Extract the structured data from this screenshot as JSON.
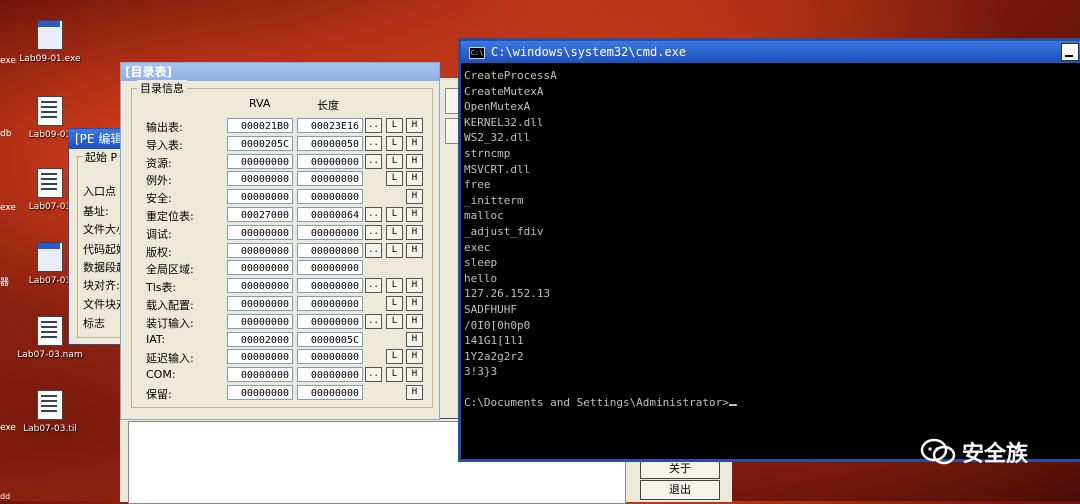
{
  "desktop": {
    "icons": [
      {
        "label": "Lab09-01.exe",
        "kind": "win"
      },
      {
        "label": "Lab09-01",
        "kind": "doc"
      },
      {
        "label": "Lab07-03",
        "kind": "doc"
      },
      {
        "label": "Lab07-03",
        "kind": "win"
      },
      {
        "label": "Lab07-03.nam",
        "kind": "doc"
      },
      {
        "label": "Lab07-03.til",
        "kind": "doc"
      }
    ],
    "edge_texts": [
      "exe",
      "db",
      "exe",
      "器",
      "exe",
      "dd"
    ]
  },
  "pe_editor": {
    "title": "[PE 编辑",
    "group_label": "起始 P",
    "fields": [
      "入口点",
      "基址:",
      "文件大小",
      "代码起始",
      "数据段起",
      "块对齐:",
      "文件块对",
      "标志"
    ]
  },
  "directory": {
    "title": "[目录表]",
    "group_label": "目录信息",
    "col_rva": "RVA",
    "col_size": "长度",
    "rows": [
      {
        "label": "输出表:",
        "rva": "000021B0",
        "size": "00023E16",
        "buttons": [
          "..",
          "L",
          "H"
        ]
      },
      {
        "label": "导入表:",
        "rva": "0000205C",
        "size": "00000050",
        "buttons": [
          "..",
          "L",
          "H"
        ]
      },
      {
        "label": "资源:",
        "rva": "00000000",
        "size": "00000000",
        "buttons": [
          "..",
          "L",
          "H"
        ]
      },
      {
        "label": "例外:",
        "rva": "00000000",
        "size": "00000000",
        "buttons": [
          "L",
          "H"
        ]
      },
      {
        "label": "安全:",
        "rva": "00000000",
        "size": "00000000",
        "buttons": [
          "H"
        ]
      },
      {
        "label": "重定位表:",
        "rva": "00027000",
        "size": "00000064",
        "buttons": [
          "..",
          "L",
          "H"
        ]
      },
      {
        "label": "调试:",
        "rva": "00000000",
        "size": "00000000",
        "buttons": [
          "..",
          "L",
          "H"
        ]
      },
      {
        "label": "版权:",
        "rva": "00000000",
        "size": "00000000",
        "buttons": [
          "..",
          "L",
          "H"
        ]
      },
      {
        "label": "全局区域:",
        "rva": "00000000",
        "size": "00000000",
        "buttons": []
      },
      {
        "label": "Tls表:",
        "rva": "00000000",
        "size": "00000000",
        "buttons": [
          "..",
          "L",
          "H"
        ]
      },
      {
        "label": "载入配置:",
        "rva": "00000000",
        "size": "00000000",
        "buttons": [
          "L",
          "H"
        ]
      },
      {
        "label": "装订输入:",
        "rva": "00000000",
        "size": "00000000",
        "buttons": [
          "..",
          "L",
          "H"
        ]
      },
      {
        "label": "IAT:",
        "rva": "00002000",
        "size": "0000005C",
        "buttons": [
          "H"
        ]
      },
      {
        "label": "延迟输入:",
        "rva": "00000000",
        "size": "00000000",
        "buttons": [
          "L",
          "H"
        ]
      },
      {
        "label": "COM:",
        "rva": "00000000",
        "size": "00000000",
        "buttons": [
          "..",
          "L",
          "H"
        ]
      },
      {
        "label": "保留:",
        "rva": "00000000",
        "size": "00000000",
        "buttons": [
          "H"
        ]
      }
    ]
  },
  "lower_panel": {
    "about_label": "关于",
    "exit_label": "退出"
  },
  "cmd": {
    "title": "C:\\windows\\system32\\cmd.exe",
    "icon_text": "C:\\",
    "lines": [
      "CreateProcessA",
      "CreateMutexA",
      "OpenMutexA",
      "KERNEL32.dll",
      "WS2_32.dll",
      "strncmp",
      "MSVCRT.dll",
      "free",
      "_initterm",
      "malloc",
      "_adjust_fdiv",
      "exec",
      "sleep",
      "hello",
      "127.26.152.13",
      "SADFHUHF",
      "/0I0[0h0p0",
      "141G1[1l1",
      "1Y2a2g2r2",
      "3!3}3",
      "",
      "C:\\Documents and Settings\\Administrator>"
    ]
  },
  "watermark": {
    "text": "安全族"
  }
}
